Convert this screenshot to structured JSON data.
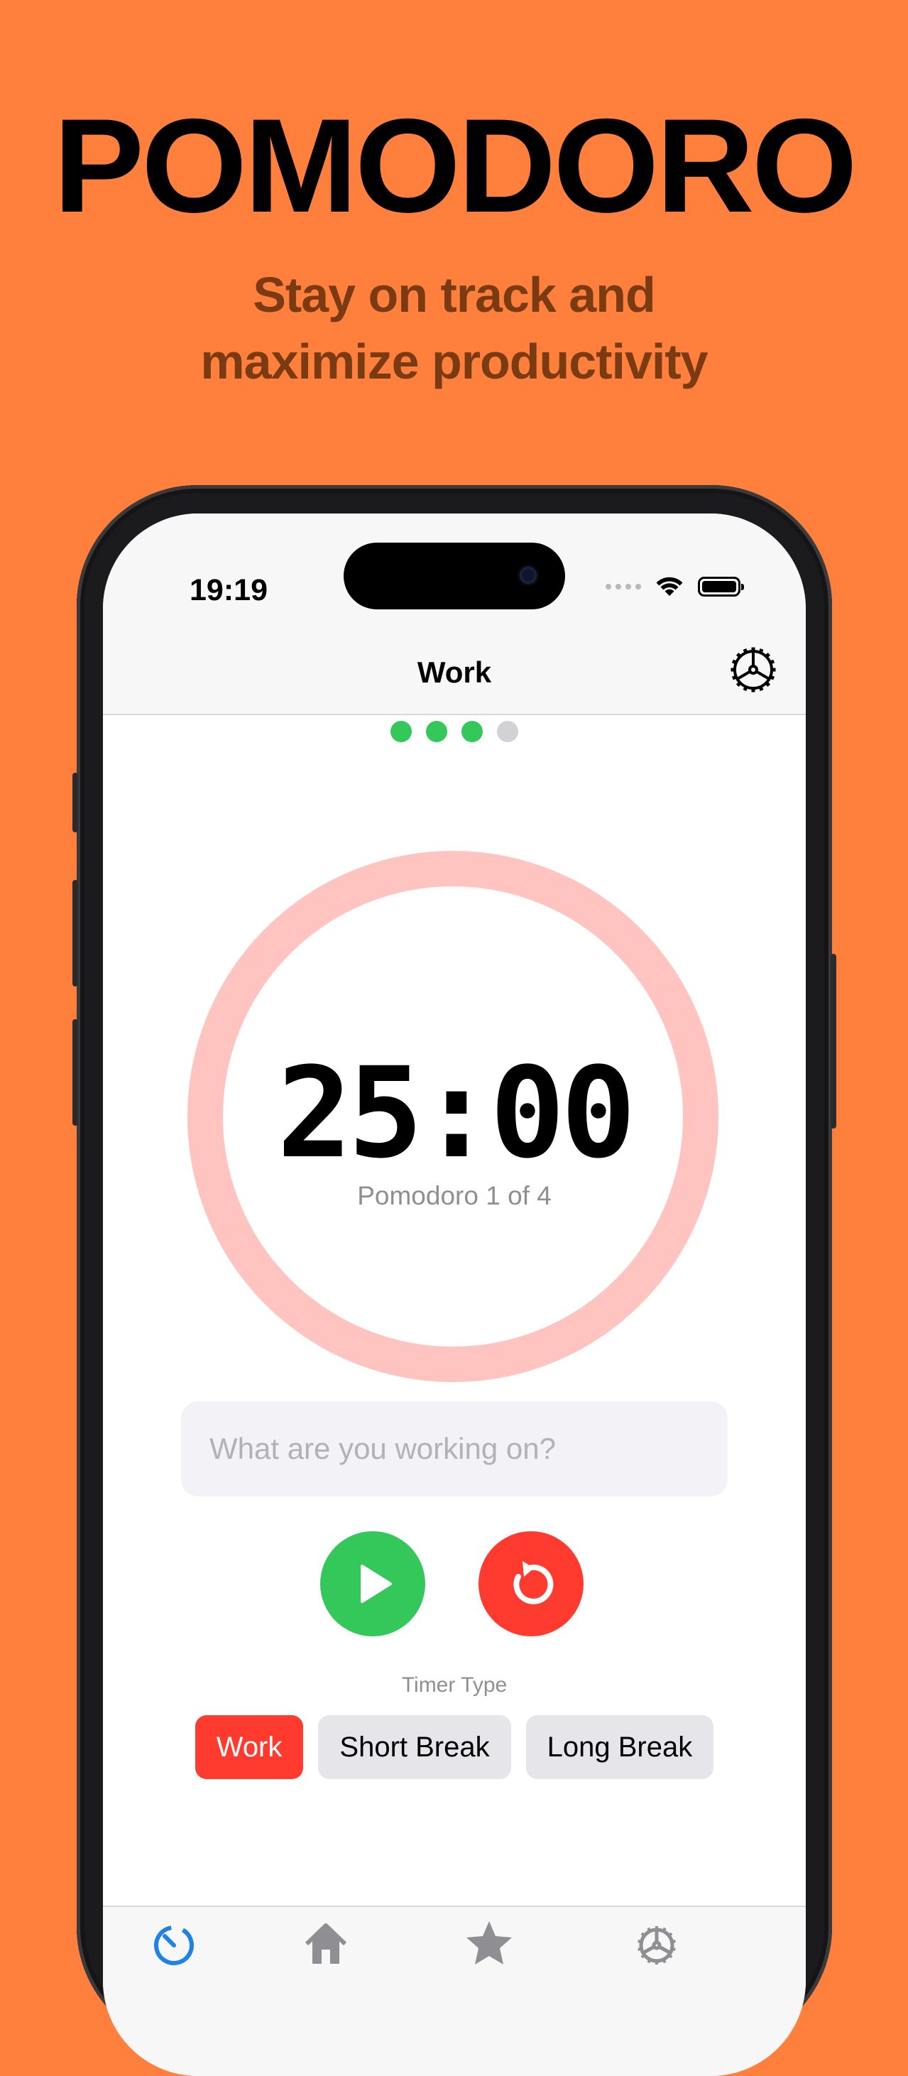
{
  "promo": {
    "headline": "POMODORO",
    "tagline_line1": "Stay on track and",
    "tagline_line2": "maximize productivity",
    "background_color": "#FF7F3C"
  },
  "status_bar": {
    "time": "19:19",
    "icons": [
      "cellular-dots-icon",
      "wifi-icon",
      "battery-icon"
    ]
  },
  "nav": {
    "title": "Work",
    "settings_icon": "gear-icon"
  },
  "session_indicator": {
    "completed": 3,
    "total": 4,
    "completed_color": "#34C759",
    "pending_color": "#D1D1D6"
  },
  "timer": {
    "display": "25:00",
    "session_label": "Pomodoro 1 of 4",
    "progress": 0,
    "ring_color": "#FFC4BF"
  },
  "task": {
    "value": "",
    "placeholder": "What are you working on?"
  },
  "controls": {
    "play_icon": "play-icon",
    "reset_icon": "reset-icon",
    "play_color": "#34C759",
    "reset_color": "#FF3B30"
  },
  "timer_type": {
    "label": "Timer Type",
    "options": [
      "Work",
      "Short Break",
      "Long Break"
    ],
    "selected": "Work",
    "selected_color": "#FF3B30"
  },
  "tab_bar": {
    "active_color": "#1E82E6",
    "items": [
      {
        "icon": "timer-icon"
      },
      {
        "icon": "house-icon"
      },
      {
        "icon": "star-icon"
      },
      {
        "icon": "gear-icon"
      }
    ]
  }
}
